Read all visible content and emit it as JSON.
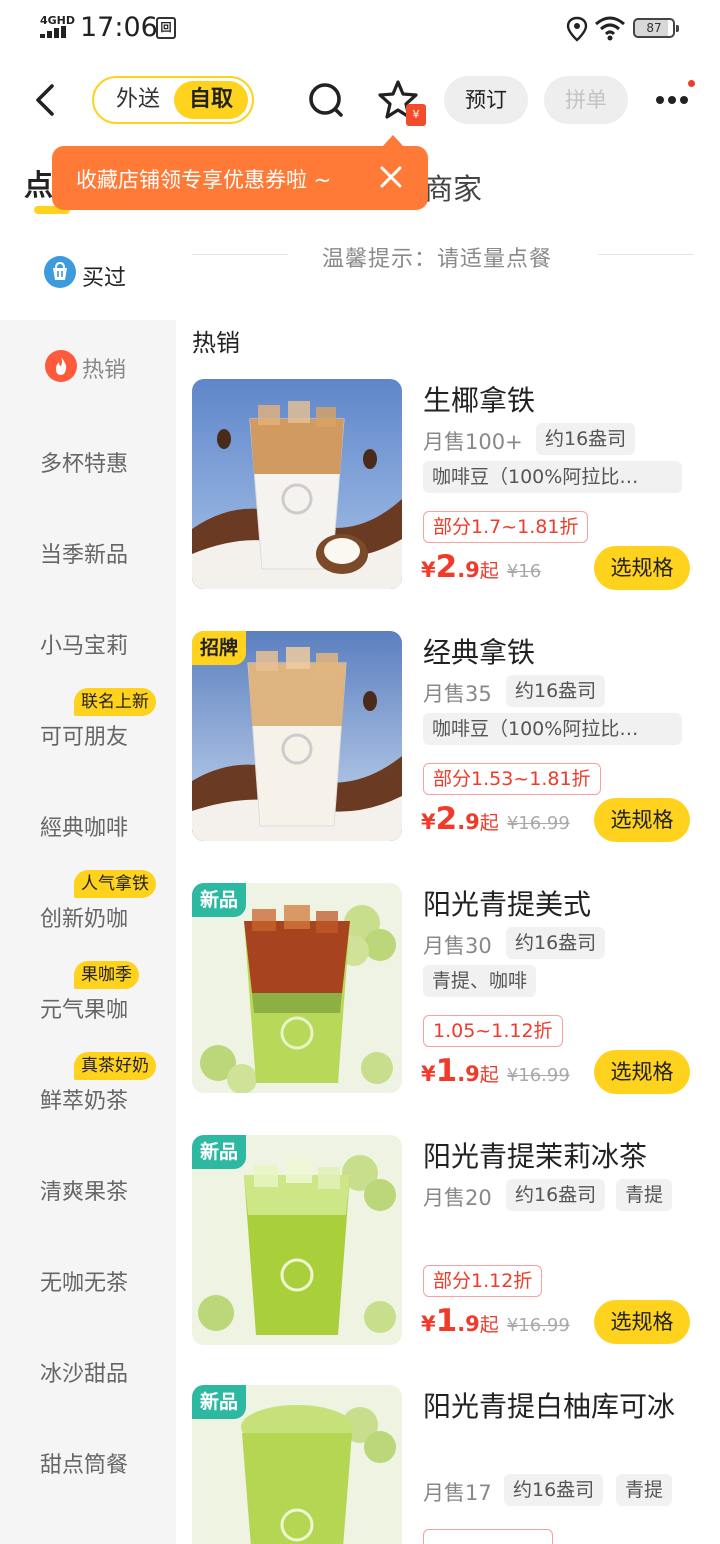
{
  "status_bar": {
    "network": "4GHD",
    "time": "17:06",
    "battery": "87"
  },
  "top_bar": {
    "mode_options": [
      "外送",
      "自取"
    ],
    "order_label": "预订",
    "group_label": "拼单",
    "coupon_mark": "¥"
  },
  "tabs": {
    "menu_initial": "点",
    "merchant_partial": "商家"
  },
  "tooltip": {
    "text": "收藏店铺领专享优惠券啦 ~"
  },
  "tip": {
    "text": "温馨提示：请适量点餐"
  },
  "bought": {
    "label": "买过"
  },
  "sidebar": {
    "items": [
      {
        "label": "热销",
        "badge": ""
      },
      {
        "label": "多杯特惠",
        "badge": ""
      },
      {
        "label": "当季新品",
        "badge": ""
      },
      {
        "label": "小马宝莉",
        "badge": ""
      },
      {
        "label": "可可朋友",
        "badge": "联名上新"
      },
      {
        "label": "經典咖啡",
        "badge": ""
      },
      {
        "label": "创新奶咖",
        "badge": "人气拿铁"
      },
      {
        "label": "元气果咖",
        "badge": "果咖季"
      },
      {
        "label": "鲜萃奶茶",
        "badge": "真茶好奶"
      },
      {
        "label": "清爽果茶",
        "badge": ""
      },
      {
        "label": "无咖无茶",
        "badge": ""
      },
      {
        "label": "冰沙甜品",
        "badge": ""
      },
      {
        "label": "甜点筒餐",
        "badge": ""
      }
    ]
  },
  "section_title": "热销",
  "products": [
    {
      "name": "生椰拿铁",
      "tag": "",
      "sales": "月售100+",
      "size": "约16盎司",
      "ingredient": "咖啡豆（100%阿拉比…",
      "discount": "部分1.7~1.81折",
      "yen": "¥",
      "price_int": "2",
      "price_dec": ".9",
      "qi": "起",
      "orig_price": "¥16",
      "spec_label": "选规格"
    },
    {
      "name": "经典拿铁",
      "tag": "招牌",
      "sales": "月售35",
      "size": "约16盎司",
      "ingredient": "咖啡豆（100%阿拉比…",
      "discount": "部分1.53~1.81折",
      "yen": "¥",
      "price_int": "2",
      "price_dec": ".9",
      "qi": "起",
      "orig_price": "¥16.99",
      "spec_label": "选规格"
    },
    {
      "name": "阳光青提美式",
      "tag": "新品",
      "sales": "月售30",
      "size": "约16盎司",
      "ingredient": "青提、咖啡",
      "discount": "1.05~1.12折",
      "yen": "¥",
      "price_int": "1",
      "price_dec": ".9",
      "qi": "起",
      "orig_price": "¥16.99",
      "spec_label": "选规格"
    },
    {
      "name": "阳光青提茉莉冰茶",
      "tag": "新品",
      "sales": "月售20",
      "size": "约16盎司",
      "ingredient": "青提",
      "discount": "部分1.12折",
      "yen": "¥",
      "price_int": "1",
      "price_dec": ".9",
      "qi": "起",
      "orig_price": "¥16.99",
      "spec_label": "选规格"
    },
    {
      "name": "阳光青提白柚库可冰",
      "tag": "新品",
      "sales": "月售17",
      "size": "约16盎司",
      "ingredient": "青提"
    }
  ],
  "colors": {
    "accent": "#ffd21e",
    "price": "#f03a2a",
    "tooltip": "#ff7a36",
    "new_tag": "#2db8a2"
  }
}
